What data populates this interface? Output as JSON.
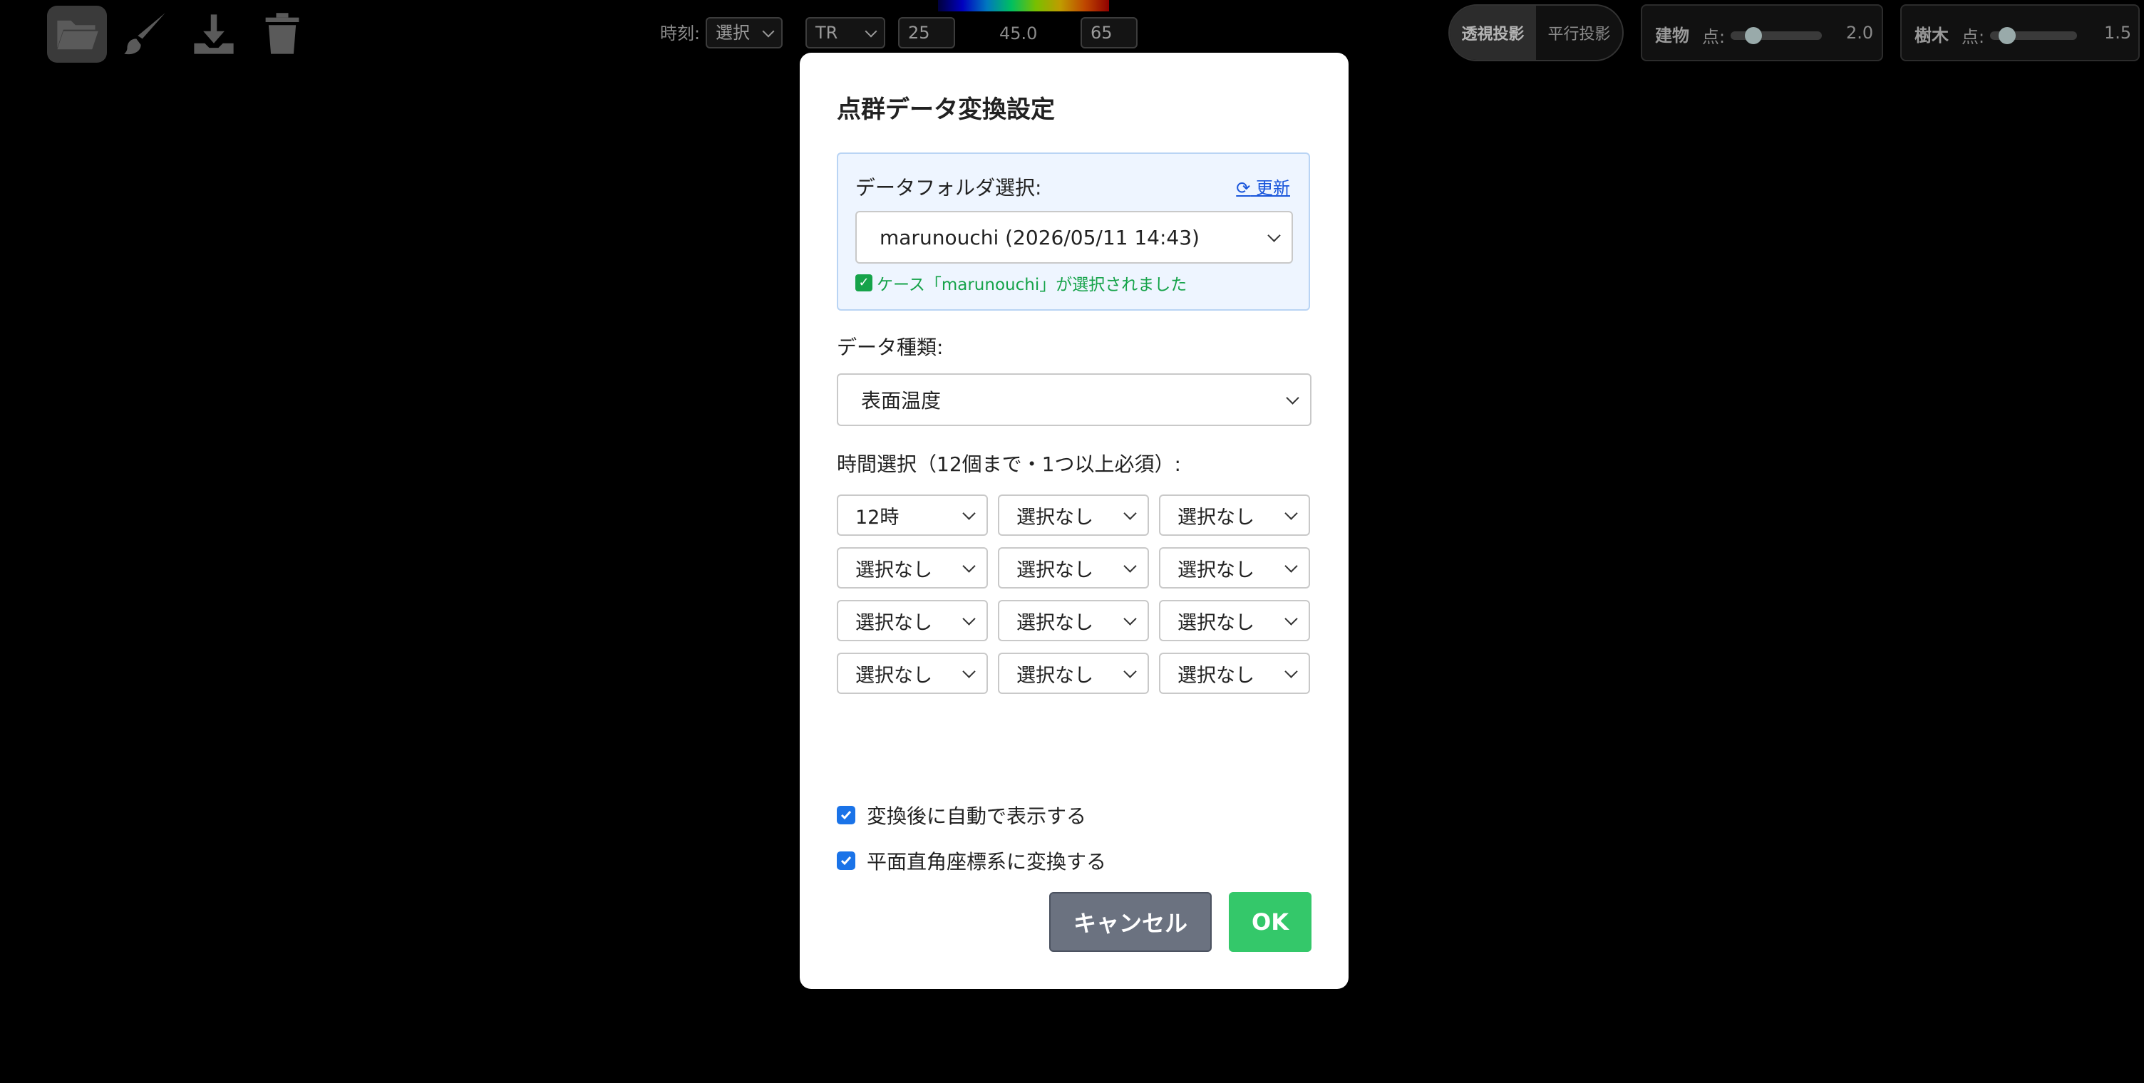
{
  "toolbar": {
    "icons": [
      "folder-icon",
      "brush-icon",
      "download-icon",
      "trash-icon"
    ],
    "time_label": "時刻:",
    "time_select_value": "選択",
    "mode_select_value": "TR",
    "range_min": "25",
    "range_mid": "45.0",
    "range_max": "65",
    "projection": {
      "perspective_label": "透視投影",
      "parallel_label": "平行投影",
      "active": "perspective"
    },
    "building": {
      "title": "建物",
      "point_label": "点:",
      "value": "2.0",
      "level": 0.25
    },
    "tree": {
      "title": "樹木",
      "point_label": "点:",
      "value": "1.5",
      "level": 0.2
    }
  },
  "modal": {
    "title": "点群データ変換設定",
    "folder": {
      "label": "データフォルダ選択:",
      "refresh_label": "更新",
      "refresh_icon": "refresh-icon",
      "selected": "marunouchi (2026/05/11 14:43)",
      "status": "ケース「marunouchi」が選択されました"
    },
    "data_type": {
      "label": "データ種類:",
      "selected": "表面温度"
    },
    "time": {
      "label": "時間選択（12個まで・1つ以上必須）:",
      "selections": [
        "12時",
        "選択なし",
        "選択なし",
        "選択なし",
        "選択なし",
        "選択なし",
        "選択なし",
        "選択なし",
        "選択なし",
        "選択なし",
        "選択なし",
        "選択なし"
      ]
    },
    "options": {
      "auto_display": {
        "label": "変換後に自動で表示する",
        "checked": true
      },
      "plane_coords": {
        "label": "平面直角座標系に変換する",
        "checked": true
      }
    },
    "cancel_label": "キャンセル",
    "ok_label": "OK"
  },
  "colors": {
    "accent_blue": "#1a73e8",
    "ok_green": "#34c86a",
    "cancel_gray": "#6b7280",
    "status_green": "#16a34a",
    "link_blue": "#1a56db"
  }
}
